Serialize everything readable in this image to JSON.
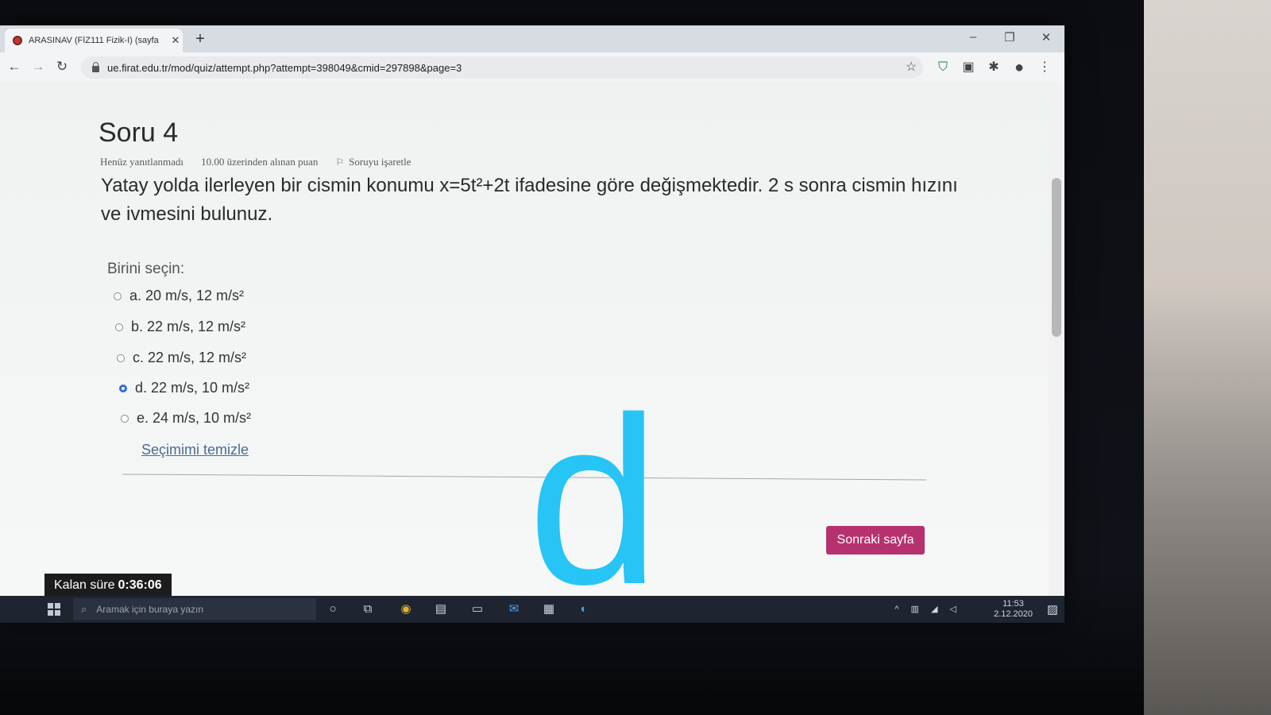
{
  "browser": {
    "tab_title": "ARASINAV (FİZ111 Fizik-I) (sayfa",
    "tab_close": "✕",
    "new_tab": "+",
    "url": "ue.firat.edu.tr/mod/quiz/attempt.php?attempt=398049&cmid=297898&page=3",
    "win_min": "–",
    "win_max": "❐",
    "win_close": "✕"
  },
  "question": {
    "title": "Soru 4",
    "status": "Henüz yanıtlanmadı",
    "points": "10.00 üzerinden alınan puan",
    "flag_label": "Soruyu işaretle",
    "text": "Yatay yolda ilerleyen bir cismin konumu x=5t²+2t ifadesine göre değişmektedir. 2 s sonra cismin hızını ve ivmesini bulunuz.",
    "choose_label": "Birini seçin:",
    "options": [
      {
        "label": "a. 20 m/s, 12 m/s²",
        "selected": false
      },
      {
        "label": "b. 22 m/s, 12 m/s²",
        "selected": false
      },
      {
        "label": "c. 22 m/s, 12 m/s²",
        "selected": false
      },
      {
        "label": "d. 22 m/s, 10 m/s²",
        "selected": true
      },
      {
        "label": "e. 24 m/s, 10 m/s²",
        "selected": false
      }
    ],
    "clear_label": "Seçimimi temizle"
  },
  "navigation": {
    "next_label": "Sonraki sayfa"
  },
  "timer": {
    "label": "Kalan süre",
    "value": "0:36:06"
  },
  "taskbar": {
    "search_placeholder": "Aramak için buraya yazın",
    "time": "11:53",
    "date": "2.12.2020"
  },
  "overlay": {
    "letter": "d"
  },
  "colors": {
    "accent": "#b5326f",
    "overlay": "#27c4f6",
    "radio_selected": "#2f6fd6"
  }
}
